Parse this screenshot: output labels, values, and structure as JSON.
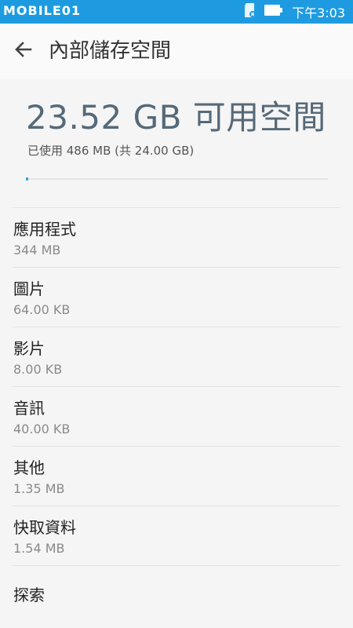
{
  "status_bar": {
    "watermark": "MOBILE01",
    "time": "下午3:03",
    "icons": [
      "sd-card-icon",
      "battery-icon"
    ],
    "color": "#1e9be0"
  },
  "toolbar": {
    "back_icon": "arrow-left-icon",
    "title": "內部儲存空間"
  },
  "summary": {
    "free": "23.52 GB 可用空間",
    "used": "已使用 486 MB (共 24.00 GB)",
    "used_fraction": 0.02
  },
  "items": [
    {
      "label": "應用程式",
      "size": "344 MB"
    },
    {
      "label": "圖片",
      "size": "64.00 KB"
    },
    {
      "label": "影片",
      "size": "8.00 KB"
    },
    {
      "label": "音訊",
      "size": "40.00 KB"
    },
    {
      "label": "其他",
      "size": "1.35 MB"
    },
    {
      "label": "快取資料",
      "size": "1.54 MB"
    },
    {
      "label": "探索"
    }
  ]
}
